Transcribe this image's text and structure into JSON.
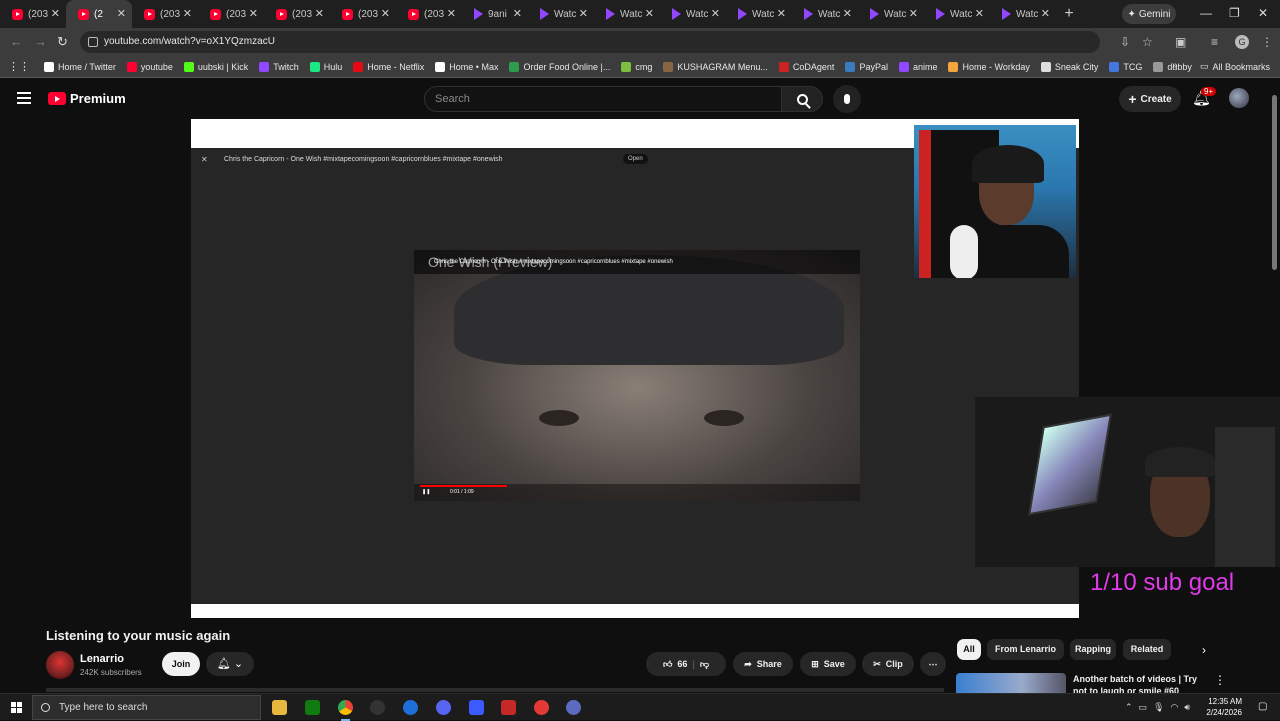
{
  "browser": {
    "tabs": [
      {
        "title": "(203",
        "icon": "youtube-icon",
        "active": false
      },
      {
        "title": "(2",
        "icon": "youtube-icon",
        "active": true
      },
      {
        "title": "(203",
        "icon": "youtube-icon",
        "active": false
      },
      {
        "title": "(203",
        "icon": "youtube-icon",
        "active": false
      },
      {
        "title": "(203",
        "icon": "youtube-icon",
        "active": false
      },
      {
        "title": "(203",
        "icon": "youtube-icon",
        "active": false
      },
      {
        "title": "(203",
        "icon": "youtube-icon",
        "active": false
      },
      {
        "title": "9ani",
        "icon": "twitch-icon",
        "active": false
      },
      {
        "title": "Watc",
        "icon": "twitch-icon",
        "active": false
      },
      {
        "title": "Watc",
        "icon": "twitch-icon",
        "active": false
      },
      {
        "title": "Watc",
        "icon": "twitch-icon",
        "active": false
      },
      {
        "title": "Watc",
        "icon": "twitch-icon",
        "active": false
      },
      {
        "title": "Watc",
        "icon": "twitch-icon",
        "active": false
      },
      {
        "title": "Watc",
        "icon": "twitch-icon",
        "active": false
      },
      {
        "title": "Watc",
        "icon": "twitch-icon",
        "active": false
      },
      {
        "title": "Watc",
        "icon": "twitch-icon",
        "active": false
      }
    ],
    "gemini_label": "Gemini",
    "url": "youtube.com/watch?v=oX1YQzmzacU",
    "bookmarks": [
      {
        "label": "Home / Twitter",
        "color": "#ffffff"
      },
      {
        "label": "youtube",
        "color": "#ff0033"
      },
      {
        "label": "uubski | Kick",
        "color": "#53fc18"
      },
      {
        "label": "Twitch",
        "color": "#9146ff"
      },
      {
        "label": "Hulu",
        "color": "#1ce783"
      },
      {
        "label": "Home - Netflix",
        "color": "#e50914"
      },
      {
        "label": "Home • Max",
        "color": "#ffffff"
      },
      {
        "label": "Order Food Online |...",
        "color": "#2e9b4e"
      },
      {
        "label": "cmg",
        "color": "#7fbf3f"
      },
      {
        "label": "KUSHAGRAM Menu...",
        "color": "#886644"
      },
      {
        "label": "CoDAgent",
        "color": "#cc2222"
      },
      {
        "label": "PayPal",
        "color": "#3b7bbf"
      },
      {
        "label": "anime",
        "color": "#9146ff"
      },
      {
        "label": "Home - Workday",
        "color": "#f3a43b"
      },
      {
        "label": "Sneak City",
        "color": "#dddddd"
      },
      {
        "label": "TCG",
        "color": "#4477dd"
      },
      {
        "label": "dubby",
        "color": "#999999"
      }
    ],
    "all_bookmarks": "All Bookmarks"
  },
  "youtube": {
    "brand": "Premium",
    "search_placeholder": "Search",
    "create_label": "Create",
    "notif_badge": "9+",
    "player": {
      "inner_title": "Chris the Capricorn - One Wish #mixtapecomingsoon #capricornblues #mixtape #onewish",
      "inner_open": "Open",
      "inner_video_title": "Chris the Capricorn - One Wish #mixtapecomingsoon #capricornblues #mixtape #onewish",
      "preview_text": "One Wish (Preview)",
      "inner_time": "0:01 / 1:09",
      "progress_fraction": 0.2,
      "sub_goal": "1/10 sub goal"
    },
    "video_title": "Listening to your music again",
    "channel": {
      "name": "Lenarrio",
      "subs": "242K subscribers"
    },
    "join_label": "Join",
    "likes": "66",
    "share_label": "Share",
    "save_label": "Save",
    "clip_label": "Clip",
    "chips": [
      "All",
      "From Lenarrio",
      "Rapping",
      "Related"
    ],
    "reco_title": "Another batch of videos | Try not to laugh or smile #60"
  },
  "taskbar": {
    "search_placeholder": "Type here to search",
    "time": "12:35 AM",
    "date": "2/24/2026"
  }
}
